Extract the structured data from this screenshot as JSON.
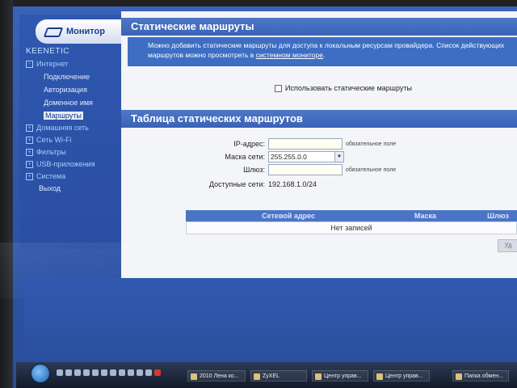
{
  "sidebar": {
    "monitor_label": "Монитор",
    "brand": "KEENETIC",
    "groups": [
      {
        "label": "Интернет",
        "sign": "-"
      },
      {
        "label": "Домашняя сеть",
        "sign": "+"
      },
      {
        "label": "Сеть Wi-Fi",
        "sign": "+"
      },
      {
        "label": "Фильтры",
        "sign": "+"
      },
      {
        "label": "USB-приложения",
        "sign": "+"
      },
      {
        "label": "Система",
        "sign": "+"
      }
    ],
    "internet_items": [
      "Подключение",
      "Авторизация",
      "Доменное имя",
      "Маршруты"
    ],
    "exit_label": "Выход"
  },
  "section1": {
    "title": "Статические маршруты",
    "info_text": "Можно добавить статические маршруты для доступа к локальным ресурсам провайдера. Список действующих маршрутов можно просмотреть в",
    "info_link": "системном мониторе",
    "info_end": ".",
    "checkbox_label": "Использовать статические маршруты"
  },
  "section2": {
    "title": "Таблица статических маршрутов",
    "ip_label": "IP-адрес:",
    "ip_hint": "обязательное поле",
    "mask_label": "Маска сети:",
    "mask_value": "255.255.0.0",
    "gateway_label": "Шлюз:",
    "gateway_hint": "обязательное поле",
    "available_label": "Доступные сети:",
    "available_value": "192.168.1.0/24"
  },
  "table": {
    "columns": [
      "Сетевой адрес",
      "Маска",
      "Шлюз"
    ],
    "empty_text": "Нет записей",
    "delete_button": "Уд"
  },
  "taskbar": {
    "items": [
      "2010 Лена ко...",
      "ZyXEL",
      "Центр управ...",
      "Центр управ...",
      "Папка обмен..."
    ]
  }
}
